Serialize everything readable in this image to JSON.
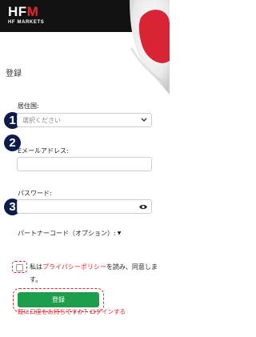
{
  "brand": {
    "logo_main": "HF",
    "logo_accent": "M",
    "logo_sub": "HF MARKETS"
  },
  "page": {
    "title": "登録"
  },
  "form": {
    "country_label": "居住国:",
    "country_placeholder": "選択ください",
    "email_label": "Eメールアドレス:",
    "email_value": "",
    "password_label": "パスワード:",
    "password_value": "",
    "partner_code_label": "パートナーコード（オプション）:",
    "consent_prefix": "私は",
    "consent_link": "プライバシーポリシー",
    "consent_suffix": "を読み、同意します。",
    "register_button": "登録",
    "login_prefix": "既に口座をお持ちですか？",
    "login_link": "ログインする"
  },
  "steps": [
    "1",
    "2",
    "3"
  ],
  "icons": {
    "chevron": "chevron-down-icon",
    "eye": "eye-icon",
    "flag": "japan-flag"
  },
  "colors": {
    "header_bg": "#111111",
    "brand_red": "#e8262d",
    "button_green": "#1e9e4a",
    "step_badge": "#0b1c4a",
    "highlight": "#e1262d"
  }
}
